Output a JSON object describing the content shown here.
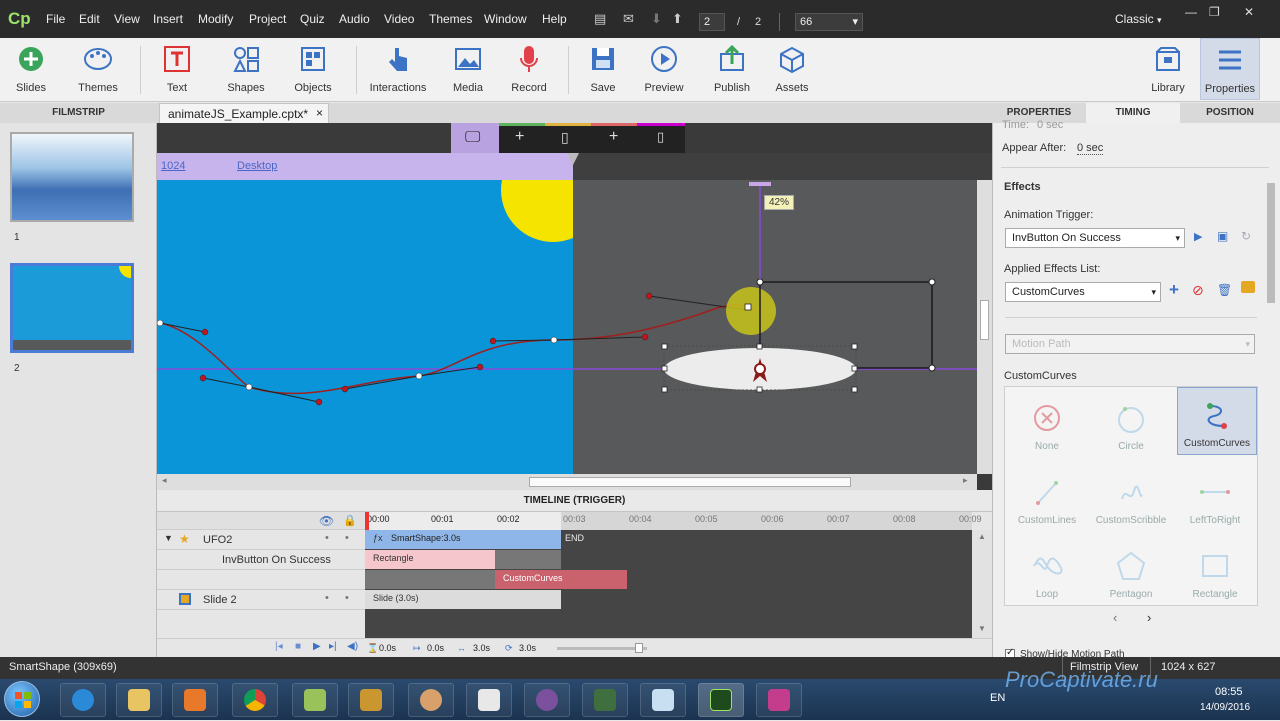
{
  "menubar": {
    "logo": "Cp",
    "items": [
      "File",
      "Edit",
      "View",
      "Insert",
      "Modify",
      "Project",
      "Quiz",
      "Audio",
      "Video",
      "Themes",
      "Window",
      "Help"
    ],
    "current_slide": "2",
    "separator": "/",
    "total_slides": "2",
    "zoom": "66",
    "workspace": "Classic"
  },
  "toolbar": {
    "buttons": [
      "Slides",
      "Themes",
      "Text",
      "Shapes",
      "Objects",
      "Interactions",
      "Media",
      "Record",
      "Save",
      "Preview",
      "Publish",
      "Assets",
      "Library",
      "Properties"
    ]
  },
  "panels": {
    "filmstrip": "FILMSTRIP",
    "doc_tab": "animateJS_Example.cptx*",
    "doc_close": "×",
    "properties": "PROPERTIES",
    "timing": "TIMING",
    "position": "POSITION"
  },
  "filmstrip": {
    "slides": [
      "1",
      "2"
    ]
  },
  "stage": {
    "breakpoint_width": "1024",
    "breakpoint_name": "Desktop",
    "zoom_tooltip": "42%"
  },
  "timeline": {
    "title": "TIMELINE (TRIGGER)",
    "ticks": [
      "00:00",
      "00:01",
      "00:02",
      "00:03",
      "00:04",
      "00:05",
      "00:06",
      "00:07",
      "00:08",
      "00:09"
    ],
    "rows": [
      {
        "label": "UFO2"
      },
      {
        "label": "InvButton On Success"
      },
      {
        "label": ""
      },
      {
        "label": "Slide 2"
      }
    ],
    "bars": {
      "smartshape": "SmartShape:3.0s",
      "end": "END",
      "rectangle": "Rectangle",
      "customcurves": "CustomCurves",
      "slide": "Slide (3.0s)"
    },
    "footer": {
      "t1": "0.0s",
      "t2": "0.0s",
      "t3": "3.0s",
      "t4": "3.0s"
    }
  },
  "properties": {
    "time_label": "Time:",
    "time_value": "0 sec",
    "appear_after_label": "Appear After:",
    "appear_after_value": "0 sec",
    "effects_heading": "Effects",
    "animation_trigger_label": "Animation Trigger:",
    "animation_trigger_value": "InvButton On Success",
    "applied_effects_label": "Applied Effects List:",
    "applied_effects_value": "CustomCurves",
    "category_value": "Motion Path",
    "group_label": "CustomCurves",
    "effects": [
      "None",
      "Circle",
      "CustomCurves",
      "CustomLines",
      "CustomScribble",
      "LeftToRight",
      "Loop",
      "Pentagon",
      "Rectangle"
    ],
    "show_hide": "Show/Hide Motion Path"
  },
  "statusbar": {
    "selection": "SmartShape (309x69)",
    "view": "Filmstrip View",
    "resolution": "1024 x 627"
  },
  "taskbar": {
    "lang": "EN",
    "time": "08:55",
    "date": "14/09/2016",
    "watermark": "ProCaptivate.ru"
  },
  "colors": {
    "accent": "#4a7bd6",
    "stage_blue": "#0a95d8",
    "sun": "#f5e400",
    "path": "#7a1f1f",
    "timeline_blue": "#8fb6e8",
    "timeline_pink": "#f5c6cb"
  }
}
